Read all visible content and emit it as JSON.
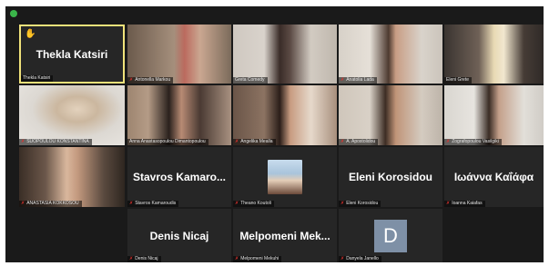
{
  "app": {
    "brand_color": "#3bb54a"
  },
  "participants": [
    {
      "name": "Thekla Katsiri",
      "label": "Thekla Katsiri",
      "video": false,
      "hand_raised": true,
      "muted": false,
      "active": true
    },
    {
      "name": "Antonella Markou",
      "label": "Antonella Markou",
      "video": true,
      "muted": true
    },
    {
      "name": "Greta Comedy",
      "label": "Greta Comedy",
      "video": true,
      "muted": false
    },
    {
      "name": "Anatolia Lada",
      "label": "Anatolia Lada",
      "video": true,
      "muted": true
    },
    {
      "name": "Eleni Grete",
      "label": "Eleni Grete",
      "video": true,
      "muted": false
    },
    {
      "name": "SUOPOULOU KONSTANTINA",
      "label": "SUOPOULOU KONSTANTINA",
      "video": true,
      "muted": true
    },
    {
      "name": "Anna Anastasopoulou Dimantopoulou",
      "label": "Anna Anastasopoulou Dimantopoulou",
      "video": true,
      "muted": false
    },
    {
      "name": "Angelika Mealla",
      "label": "Angelika Mealla",
      "video": true,
      "muted": true
    },
    {
      "name": "A. Apostolidou",
      "label": "A. Apostolidou",
      "video": true,
      "muted": true
    },
    {
      "name": "Zografopoulou Vasilgiki",
      "label": "Zografopoulou Vasilgiki",
      "video": true,
      "muted": true
    },
    {
      "name": "ANASTASIA KOKKOSOU",
      "label": "ANASTASIA KOKKOSOU",
      "video": true,
      "muted": true
    },
    {
      "name": "Stavros Kamaro...",
      "label": "Stavros Kamaroudis",
      "video": false,
      "muted": true
    },
    {
      "name": "Theano Koutoli",
      "label": "Theano Koutoli",
      "video": false,
      "avatar": true,
      "muted": true
    },
    {
      "name": "Eleni Korosidou",
      "label": "Eleni Korosidou",
      "video": false,
      "muted": true
    },
    {
      "name": "Ιωάννα Καΐάφα",
      "label": "Ioanna Kaiafas",
      "video": false,
      "muted": true
    },
    {
      "name": "Denis Nicaj",
      "label": "Denis Nicaj",
      "video": false,
      "muted": true
    },
    {
      "name": "Melpomeni Mek...",
      "label": "Melpomeni Mekuhi",
      "video": false,
      "muted": true
    },
    {
      "name": "D",
      "label": "Danyela Janello",
      "video": false,
      "letter": "D",
      "muted": true
    }
  ]
}
